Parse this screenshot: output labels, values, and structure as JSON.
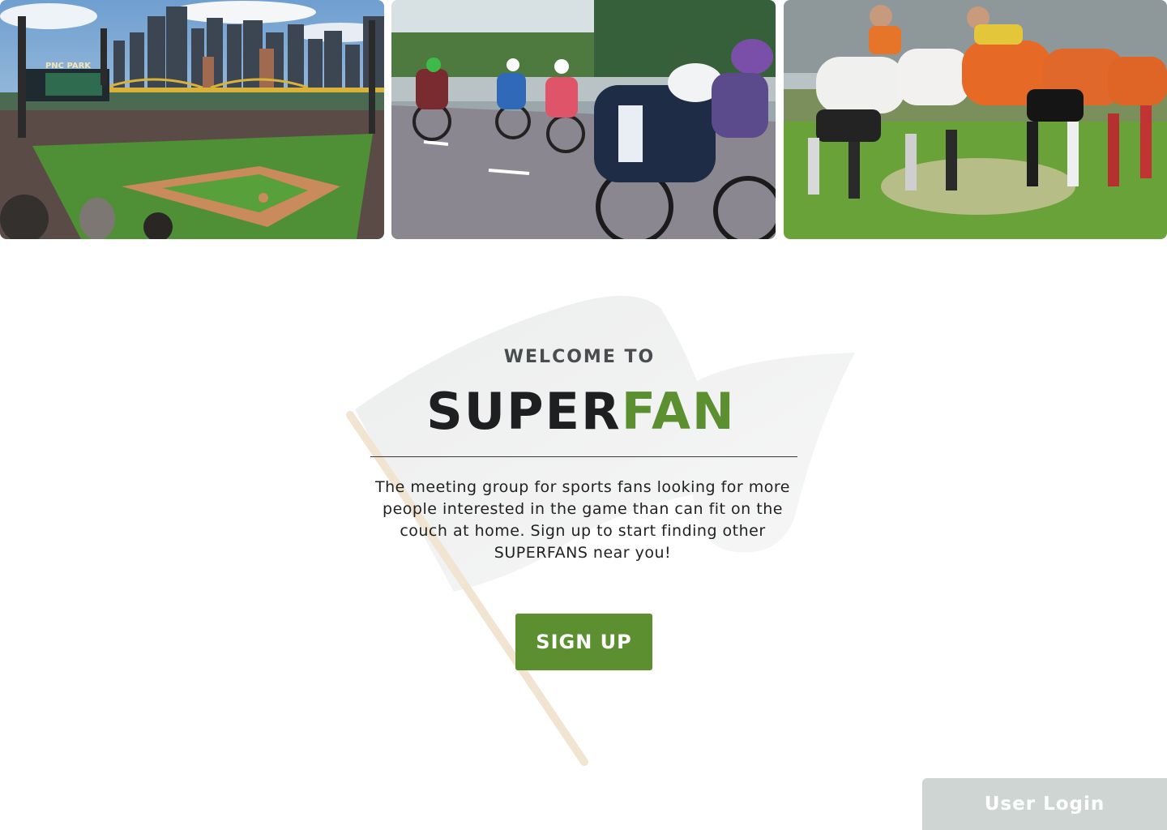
{
  "hero": {
    "images": [
      {
        "name": "baseball-stadium-photo",
        "sign_text": "PNC PARK"
      },
      {
        "name": "cycling-race-photo"
      },
      {
        "name": "rugby-scrum-photo"
      }
    ]
  },
  "main": {
    "welcome_text": "WELCOME TO",
    "brand_part1": "SUPER",
    "brand_part2": "FAN",
    "tagline": "The meeting group for sports fans looking for more people interested in the game than can fit on the couch at home. Sign up to start finding other SUPERFANS near you!",
    "signup_label": "SIGN UP"
  },
  "footer": {
    "login_label": "User Login"
  },
  "colors": {
    "brand_green": "#5c8f30",
    "brand_dark": "#1e1f21",
    "login_bg": "#cfd5d2"
  }
}
